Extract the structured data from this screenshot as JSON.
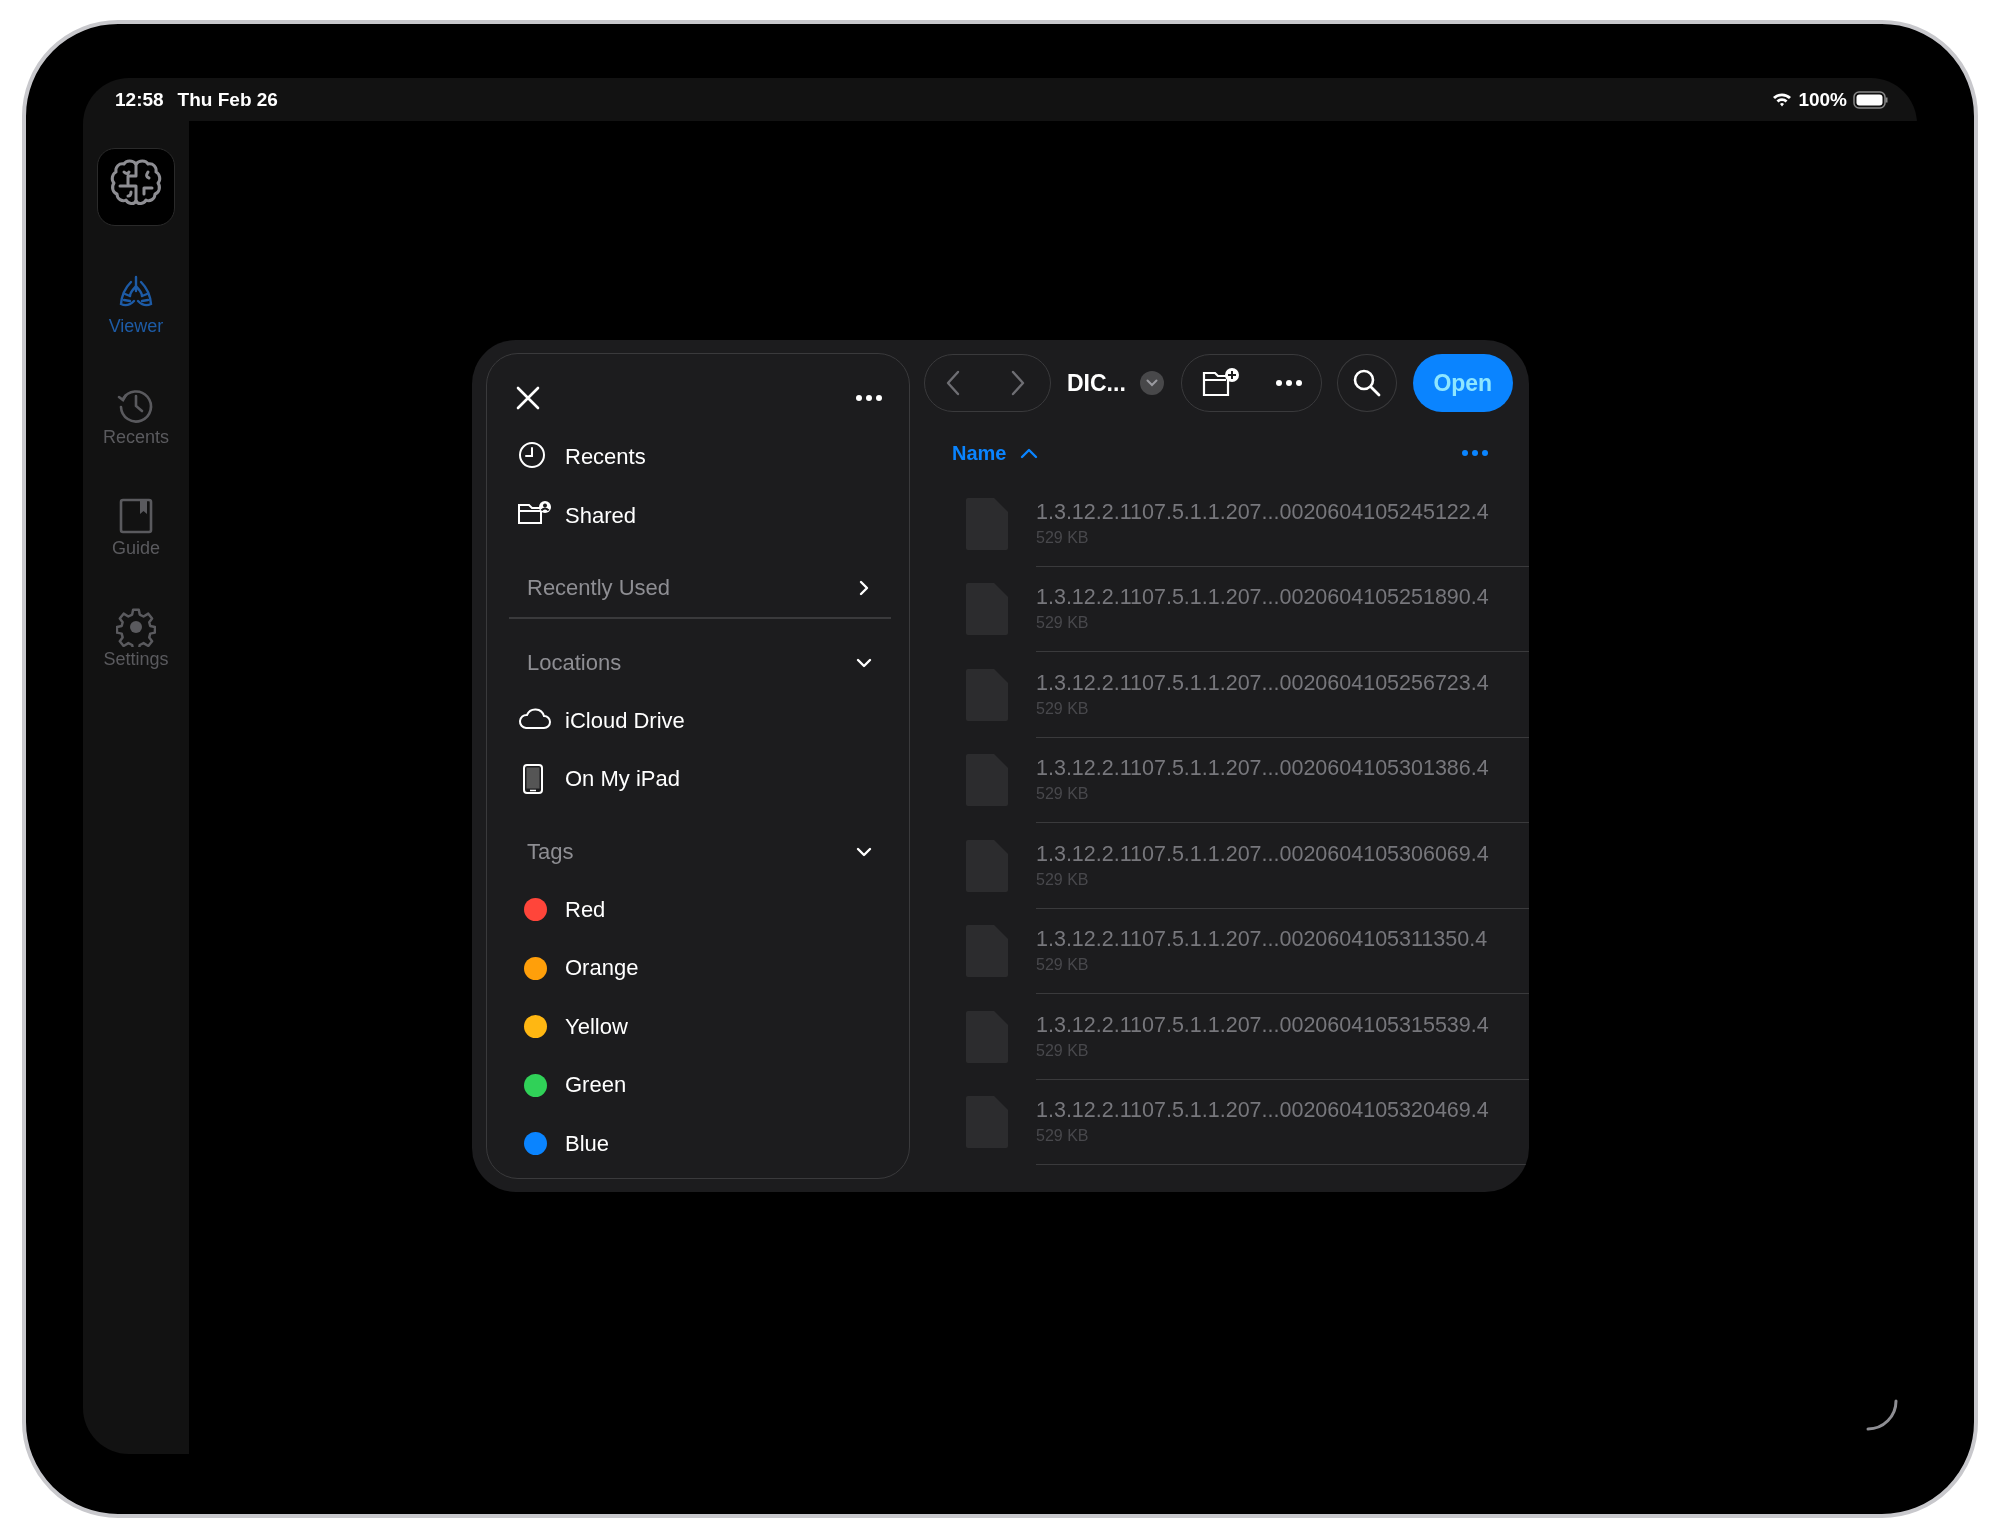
{
  "status_bar": {
    "time": "12:58",
    "date": "Thu Feb 26",
    "battery": "100%"
  },
  "rail": {
    "items": [
      {
        "label": "Viewer",
        "kind": "lungs",
        "selected": true
      },
      {
        "label": "Recents",
        "kind": "history",
        "selected": false
      },
      {
        "label": "Guide",
        "kind": "book",
        "selected": false
      },
      {
        "label": "Settings",
        "kind": "gear",
        "selected": false
      }
    ]
  },
  "dialog": {
    "sidebar": {
      "top_items": [
        {
          "label": "Recents",
          "kind": "clock"
        },
        {
          "label": "Shared",
          "kind": "shared"
        }
      ],
      "sections": [
        {
          "title": "Recently Used",
          "expanded": false
        },
        {
          "title": "Locations",
          "expanded": true,
          "items": [
            {
              "label": "iCloud Drive",
              "kind": "cloud"
            },
            {
              "label": "On My iPad",
              "kind": "ipad"
            }
          ]
        },
        {
          "title": "Tags",
          "expanded": true,
          "items": [
            {
              "label": "Red",
              "kind": "tag",
              "color": "#ff453a"
            },
            {
              "label": "Orange",
              "kind": "tag",
              "color": "#ff9f0a"
            },
            {
              "label": "Yellow",
              "kind": "tag",
              "color": "#ffb712"
            },
            {
              "label": "Green",
              "kind": "tag",
              "color": "#30d158"
            },
            {
              "label": "Blue",
              "kind": "tag",
              "color": "#0a84ff"
            }
          ]
        }
      ]
    },
    "toolbar": {
      "folder": "DIC...",
      "open_button": "Open"
    },
    "list_header": {
      "sort_label": "Name",
      "ascending": true
    },
    "files": [
      {
        "name": "1.3.12.2.1107.5.1.1.207...0020604105245122.4",
        "size": "529 KB"
      },
      {
        "name": "1.3.12.2.1107.5.1.1.207...0020604105251890.4",
        "size": "529 KB"
      },
      {
        "name": "1.3.12.2.1107.5.1.1.207...0020604105256723.4",
        "size": "529 KB"
      },
      {
        "name": "1.3.12.2.1107.5.1.1.207...0020604105301386.4",
        "size": "529 KB"
      },
      {
        "name": "1.3.12.2.1107.5.1.1.207...0020604105306069.4",
        "size": "529 KB"
      },
      {
        "name": "1.3.12.2.1107.5.1.1.207...0020604105311350.4",
        "size": "529 KB"
      },
      {
        "name": "1.3.12.2.1107.5.1.1.207...0020604105315539.4",
        "size": "529 KB"
      },
      {
        "name": "1.3.12.2.1107.5.1.1.207...0020604105320469.4",
        "size": "529 KB"
      }
    ]
  }
}
